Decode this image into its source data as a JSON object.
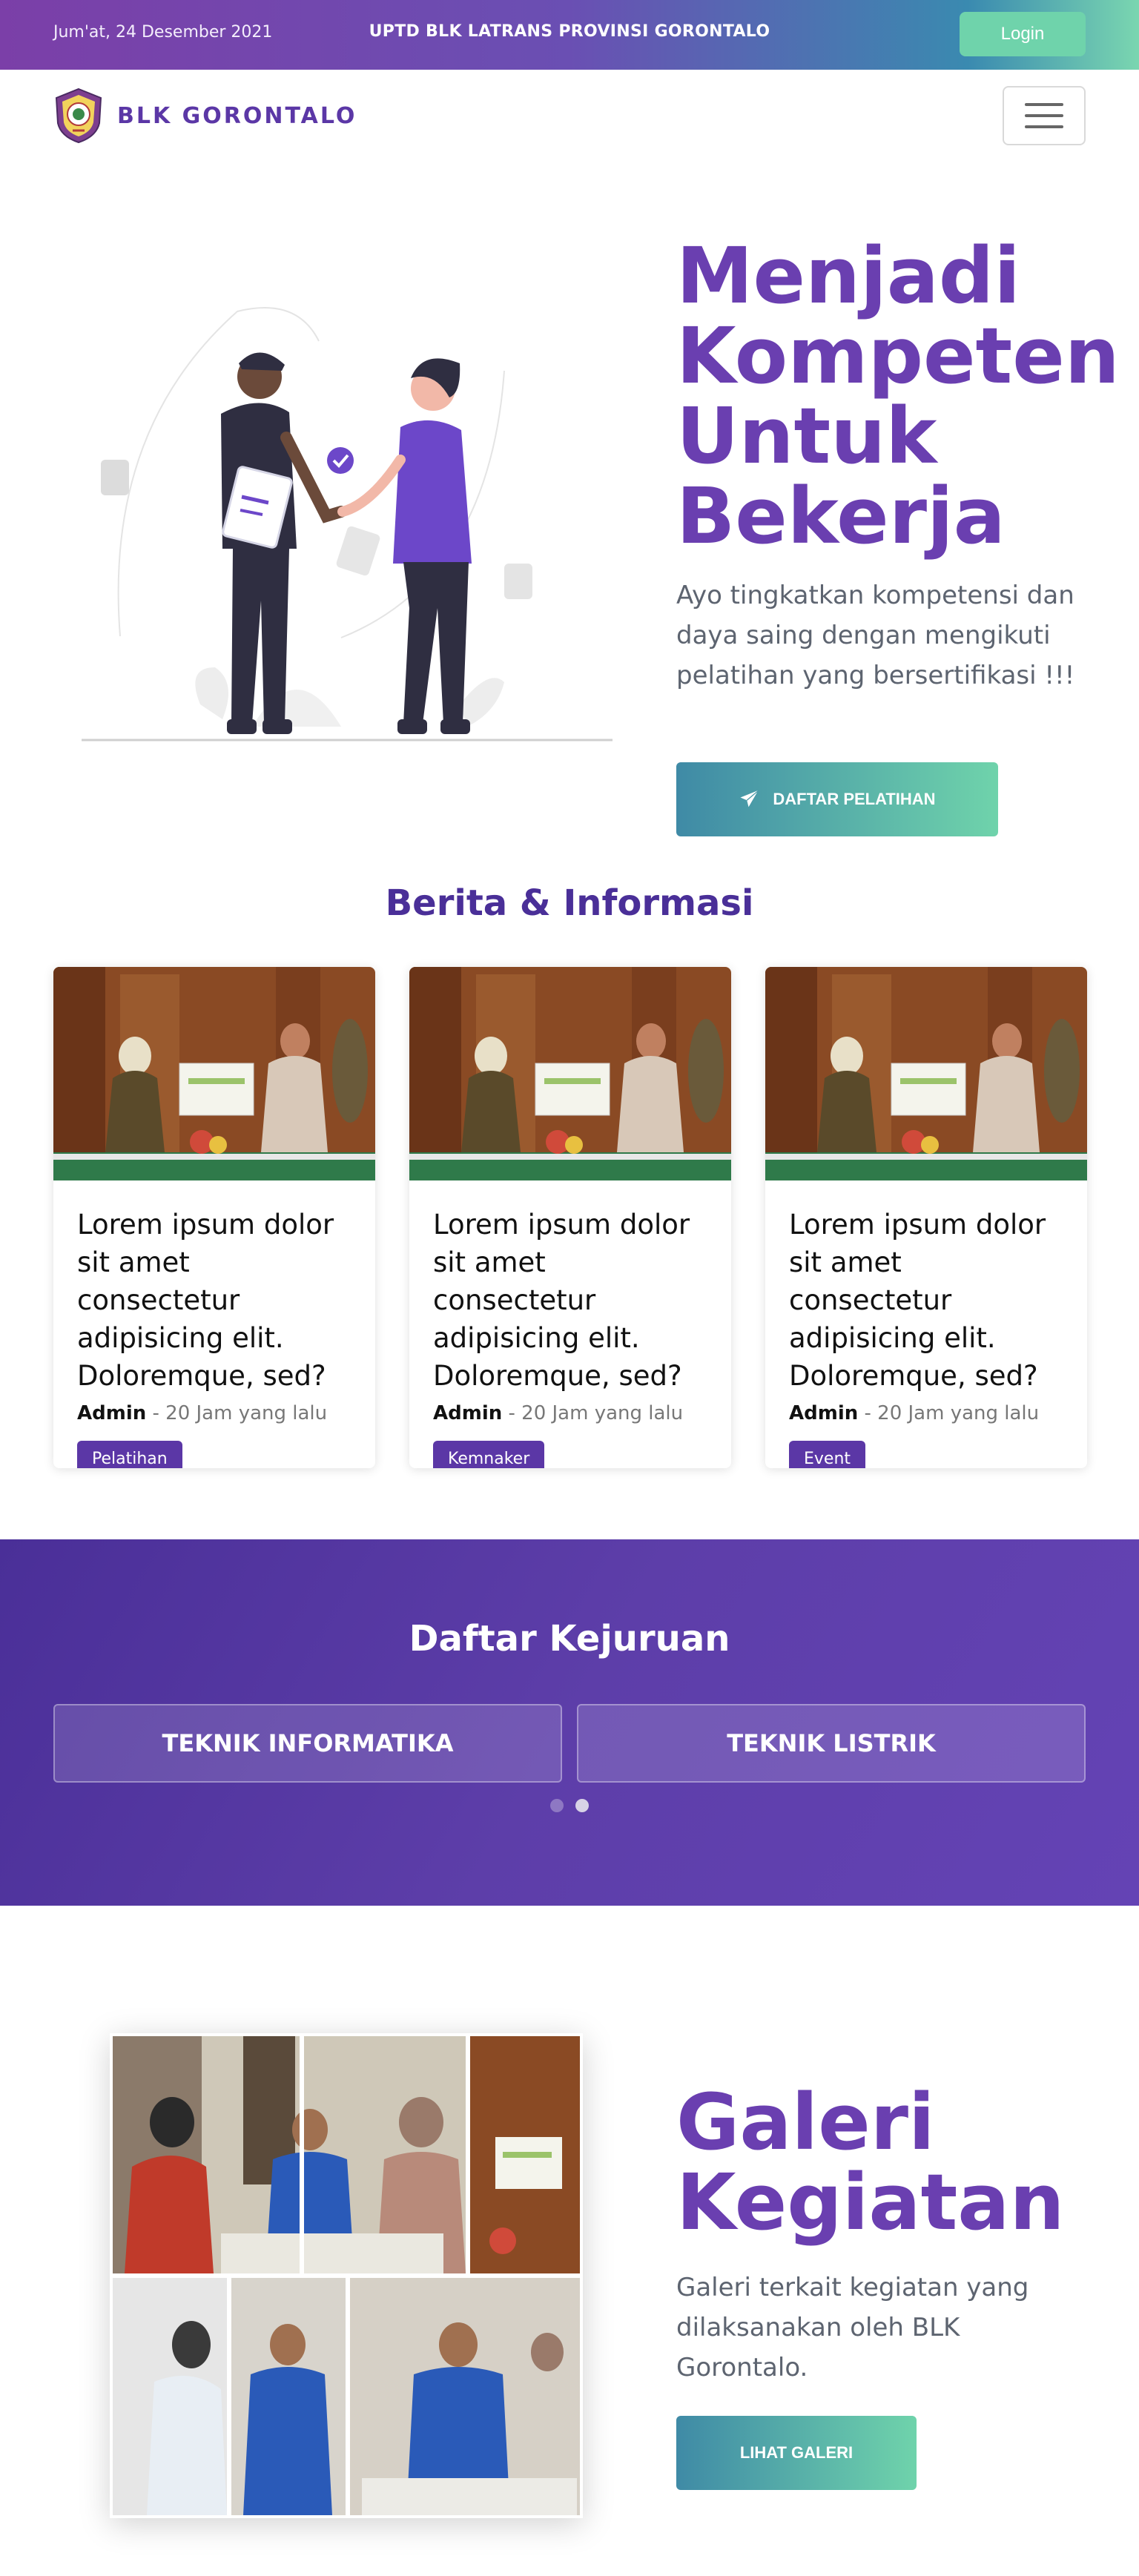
{
  "topbar": {
    "date": "Jum'at, 24 Desember 2021",
    "org": "UPTD BLK LATRANS PROVINSI GORONTALO",
    "login_label": "Login"
  },
  "nav": {
    "brand_name": "BLK GORONTALO"
  },
  "hero": {
    "title": "Menjadi Kompeten Untuk Bekerja",
    "subtitle": "Ayo tingkatkan kompetensi dan daya saing dengan mengikuti pelatihan yang bersertifikasi !!!",
    "cta_label": "DAFTAR PELATIHAN"
  },
  "news": {
    "section_title": "Berita & Informasi",
    "cards": [
      {
        "title": "Lorem ipsum dolor sit amet consectetur adipisicing elit. Doloremque, sed?",
        "author": "Admin",
        "time": " - 20 Jam yang lalu",
        "tag": "Pelatihan"
      },
      {
        "title": "Lorem ipsum dolor sit amet consectetur adipisicing elit. Doloremque, sed?",
        "author": "Admin",
        "time": " - 20 Jam yang lalu",
        "tag": "Kemnaker"
      },
      {
        "title": "Lorem ipsum dolor sit amet consectetur adipisicing elit. Doloremque, sed?",
        "author": "Admin",
        "time": " - 20 Jam yang lalu",
        "tag": "Event"
      }
    ]
  },
  "kejuruan": {
    "section_title": "Daftar Kejuruan",
    "items": [
      "TEKNIK INFORMATIKA",
      "TEKNIK LISTRIK"
    ],
    "carousel_active_index": 1
  },
  "galeri": {
    "title": "Galeri Kegiatan",
    "subtitle": "Galeri terkait kegiatan yang dilaksanakan oleh BLK Gorontalo.",
    "cta_label": "LIHAT GALERI"
  },
  "colors": {
    "brand_purple": "#5b37a6",
    "title_purple": "#6a3fb0",
    "accent_green": "#6fd3ab",
    "accent_teal": "#3f8aa6"
  },
  "icons": [
    "logo-emblem",
    "hamburger-menu-icon",
    "paper-plane-icon"
  ]
}
